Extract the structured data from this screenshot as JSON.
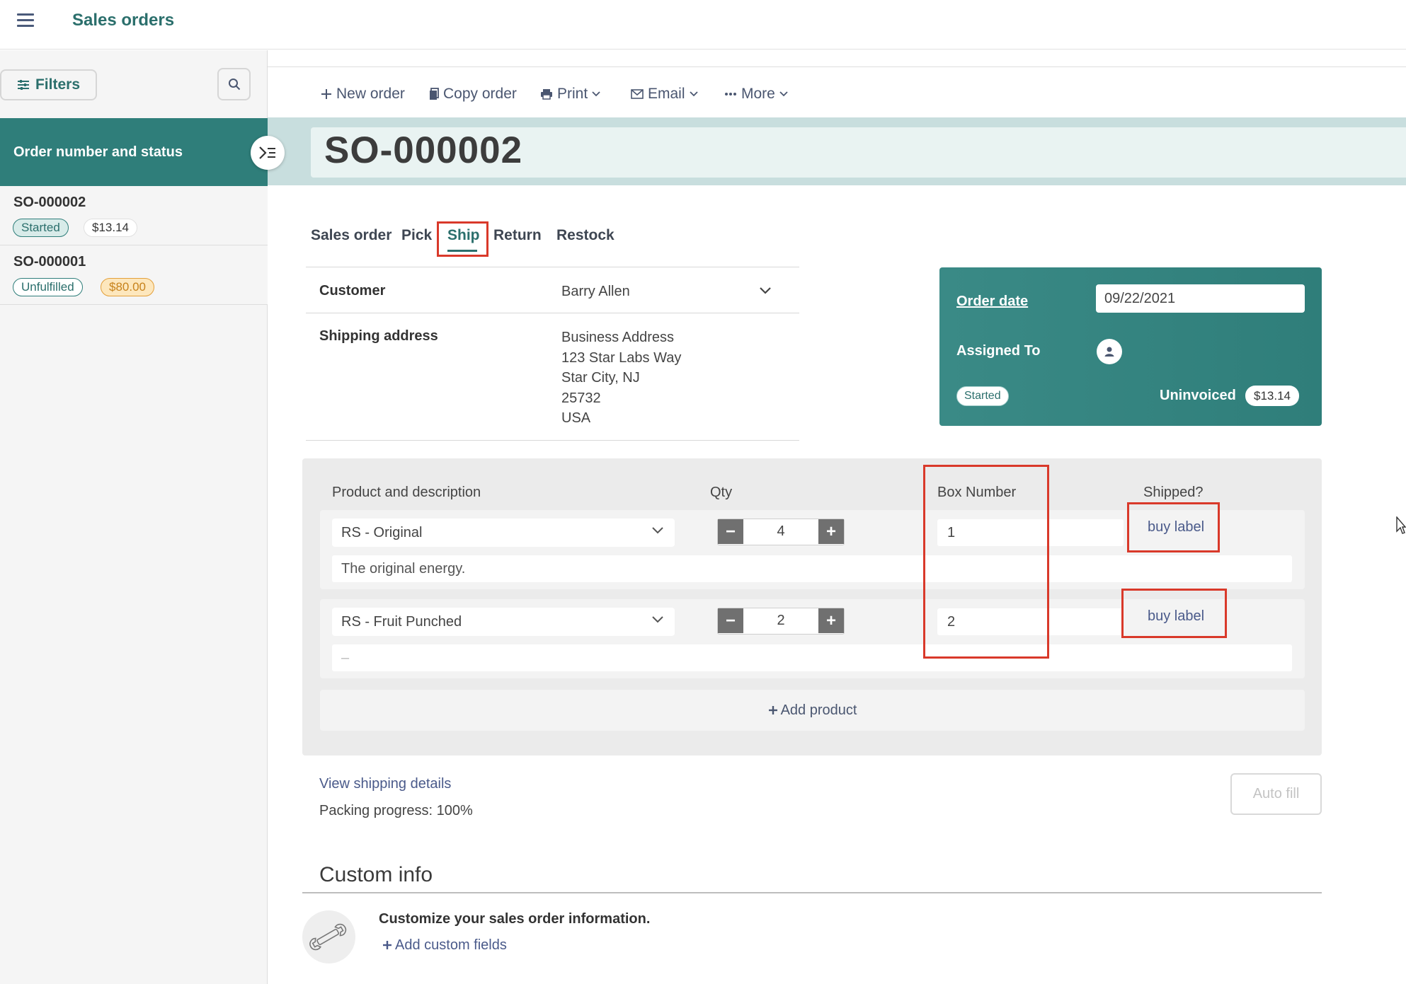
{
  "app": {
    "title": "Sales orders"
  },
  "sidebar": {
    "filters_label": "Filters",
    "list_header": "Order number and status",
    "orders": [
      {
        "number": "SO-000002",
        "status": "Started",
        "amount": "$13.14"
      },
      {
        "number": "SO-000001",
        "status": "Unfulfilled",
        "amount": "$80.00"
      }
    ]
  },
  "toolbar": {
    "new_order": "New order",
    "copy_order": "Copy order",
    "print": "Print",
    "email": "Email",
    "more": "More"
  },
  "order": {
    "title": "SO-000002",
    "tabs": [
      "Sales order",
      "Pick",
      "Ship",
      "Return",
      "Restock"
    ],
    "active_tab": "Ship",
    "customer_label": "Customer",
    "customer_value": "Barry Allen",
    "shipping_label": "Shipping address",
    "shipping_lines": [
      "Business Address",
      "123 Star Labs Way",
      "Star City, NJ",
      "25732",
      "USA"
    ]
  },
  "card": {
    "order_date_label": "Order date",
    "order_date_value": "09/22/2021",
    "assigned_label": "Assigned To",
    "status": "Started",
    "invoice_status": "Uninvoiced",
    "total": "$13.14"
  },
  "products": {
    "headers": {
      "product": "Product and description",
      "qty": "Qty",
      "box": "Box Number",
      "shipped": "Shipped?"
    },
    "rows": [
      {
        "product": "RS - Original",
        "qty": "4",
        "box": "1",
        "action": "buy label",
        "description": "The original energy."
      },
      {
        "product": "RS - Fruit Punched",
        "qty": "2",
        "box": "2",
        "action": "buy label",
        "description": "–"
      }
    ],
    "add_label": "Add product"
  },
  "shipping": {
    "view_details": "View shipping details",
    "packing_progress": "Packing progress: 100%",
    "autofill": "Auto fill"
  },
  "custom_info": {
    "title": "Custom info",
    "description": "Customize your sales order information.",
    "add_label": "Add custom fields"
  },
  "colors": {
    "brand": "#2f7e7a",
    "highlight": "#d9392a",
    "link": "#4a5a8a"
  }
}
